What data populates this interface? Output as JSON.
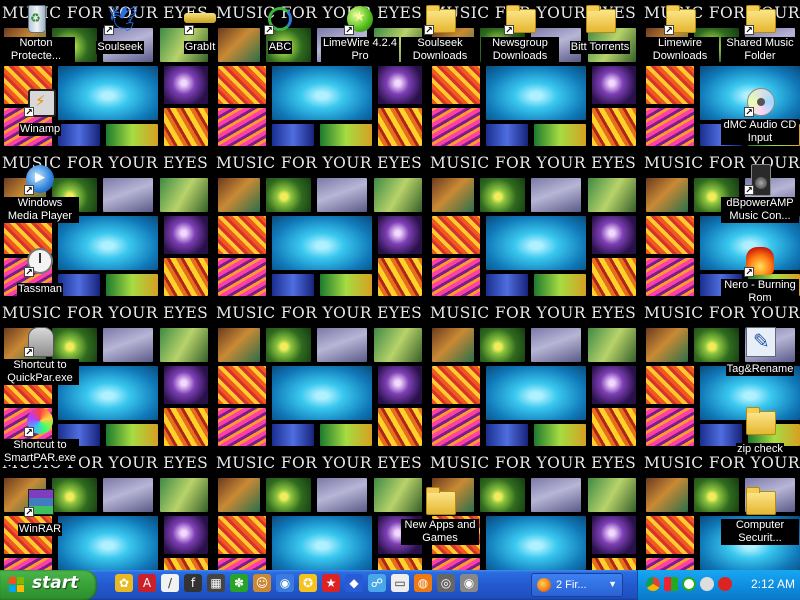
{
  "wallpaper": {
    "caption": "MUSIC FOR YOUR EYES"
  },
  "desktop_icons": {
    "recycle_bin": "Norton Protecte...",
    "soulseek": "Soulseek",
    "grabit": "GrabIt",
    "abc": "ABC",
    "limewire": "LimeWire 4.2.4 Pro",
    "soulseek_downloads": "Soulseek Downloads",
    "newsgroup_downloads": "Newsgroup Downloads",
    "bitt_torrents": "Bitt Torrents",
    "limewire_downloads": "Limewire Downloads",
    "shared_music": "Shared Music Folder",
    "winamp": "Winamp",
    "dmc_audio": "dMC Audio CD Input",
    "wmp": "Windows Media Player",
    "dbpoweramp": "dBpowerAMP Music Con...",
    "tassman": "Tassman",
    "nero": "Nero - Burning Rom",
    "quickpar": "Shortcut to QuickPar.exe",
    "tagrename": "Tag&Rename",
    "smartpar": "Shortcut to SmartPAR.exe",
    "zip_check": "zip check",
    "winrar": "WinRAR",
    "new_apps": "New Apps and Games",
    "computer_security": "Computer Securit..."
  },
  "taskbar": {
    "start_label": "start",
    "task_button": "2 Fir...",
    "clock": "2:12 AM"
  },
  "colors": {
    "taskbar_blue": "#245dd7",
    "start_green": "#3aa53a",
    "tray_blue": "#0f8fe0",
    "label_bg": "#000000"
  },
  "icon_names": {
    "quick_launch": [
      "sunflower-icon",
      "acrobat-icon",
      "notepad-icon",
      "tool-icon",
      "grid-icon",
      "flower-icon",
      "person-icon",
      "globe-icon",
      "badge-icon",
      "star-icon",
      "diamond-icon",
      "network-icon",
      "window-icon",
      "firefox-icon",
      "target-icon",
      "disc-icon"
    ],
    "tray": [
      "chrome-icon",
      "colors-icon",
      "shield-icon",
      "audio-icon",
      "antivirus-icon"
    ]
  }
}
